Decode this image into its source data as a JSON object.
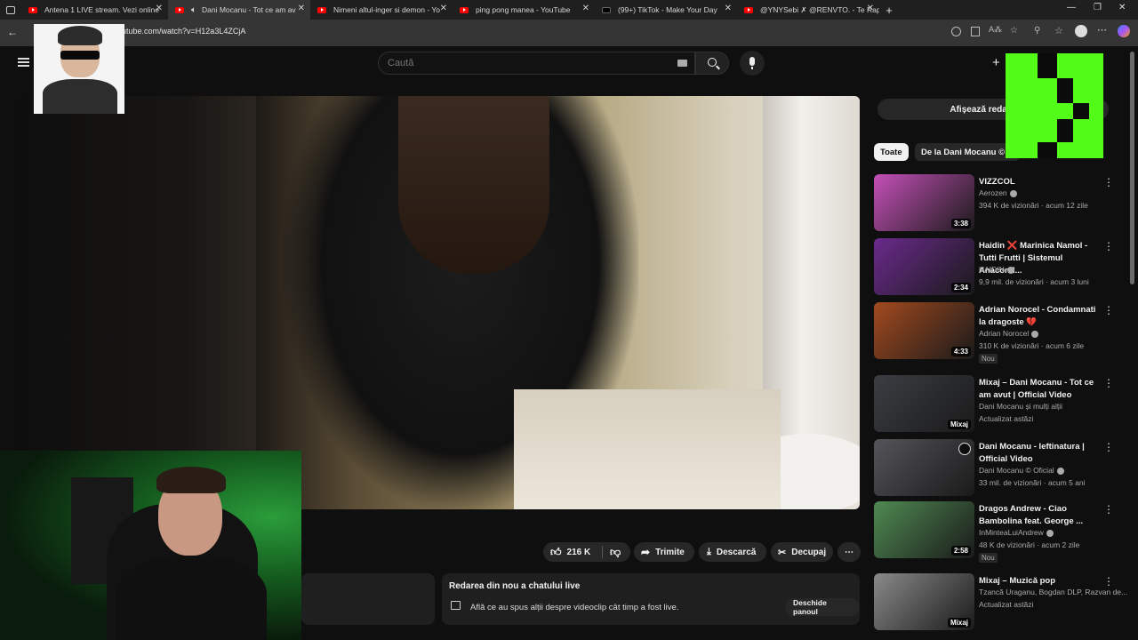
{
  "browser": {
    "tabs": [
      {
        "title": "Antena 1 LIVE stream. Vezi online",
        "favicon": "youtube-icon"
      },
      {
        "title": "Dani Mocanu - Tot ce am av",
        "favicon": "youtube-icon",
        "active": true
      },
      {
        "title": "Nimeni altul-inger si demon - Yo",
        "favicon": "youtube-icon"
      },
      {
        "title": "ping pong manea - YouTube",
        "favicon": "youtube-icon"
      },
      {
        "title": "(99+) TikTok - Make Your Day",
        "favicon": "tiktok-icon"
      },
      {
        "title": "@YNYSebi ✗ @RENVTO. - Te Rap",
        "favicon": "youtube-icon"
      }
    ],
    "url": "utube.com/watch?v=H12a3L4ZCjA"
  },
  "youtube": {
    "search_placeholder": "Caută",
    "show_live_chat_label": "Afișează redarea din",
    "chips": [
      "Toate",
      "De la Dani Mocanu © C"
    ],
    "actions": {
      "like_count": "216 K",
      "share_label": "Trimite",
      "download_label": "Descarcă",
      "clip_label": "Decupaj"
    },
    "live_replay": {
      "title": "Redarea din nou a chatului live",
      "description": "Află ce au spus alții despre videoclip cât timp a fost live.",
      "open_panel_label": "Deschide panoul"
    },
    "recommendations": [
      {
        "title": "VIZZCOL",
        "channel": "Aerozen",
        "verified": true,
        "meta": "394 K de vizionări · acum 12 zile",
        "duration": "3:38",
        "badge": "",
        "thumb_color": "#c44fb8"
      },
      {
        "title": "Haidin ❌ Marinica Namol - Tutti Frutti | Sistemul Anacond...",
        "channel": "HAIDIN",
        "verified": true,
        "meta": "9,9 mil. de vizionări · acum 3 luni",
        "duration": "2:34",
        "badge": "",
        "thumb_color": "#6a2a8c"
      },
      {
        "title": "Adrian Norocel - Condamnati la dragoste 💔",
        "channel": "Adrian Norocel",
        "verified": true,
        "meta": "310 K de vizionări · acum 6 zile",
        "duration": "4:33",
        "badge": "Nou",
        "thumb_color": "#a24a1e"
      },
      {
        "title": "Mixaj – Dani Mocanu - Tot ce am avut | Official Video",
        "channel": "Dani Mocanu și mulți alții",
        "verified": false,
        "meta": "Actualizat astăzi",
        "duration": "Mixaj",
        "badge": "",
        "thumb_color": "#3a3d42"
      },
      {
        "title": "Dani Mocanu - Ieftinatura | Official Video",
        "channel": "Dani Mocanu © Oficial",
        "verified": true,
        "meta": "33 mil. de vizionări · acum 5 ani",
        "duration": "",
        "badge": "",
        "thumb_color": "#54545a"
      },
      {
        "title": "Dragos Andrew - Ciao Bambolina feat. George ...",
        "channel": "InMinteaLuiAndrew",
        "verified": true,
        "meta": "48 K de vizionări · acum 2 zile",
        "duration": "2:58",
        "badge": "Nou",
        "thumb_color": "#4f8a52"
      },
      {
        "title": "Mixaj – Muzică pop",
        "channel": "Tzancă Uraganu, Bogdan DLP, Razvan de...",
        "verified": false,
        "meta": "Actualizat astăzi",
        "duration": "Mixaj",
        "badge": "",
        "thumb_color": "#8a8a8a"
      }
    ]
  },
  "colors": {
    "background": "#0f0f0f",
    "kick_green": "#53fc18",
    "youtube_red": "#ff0000"
  }
}
